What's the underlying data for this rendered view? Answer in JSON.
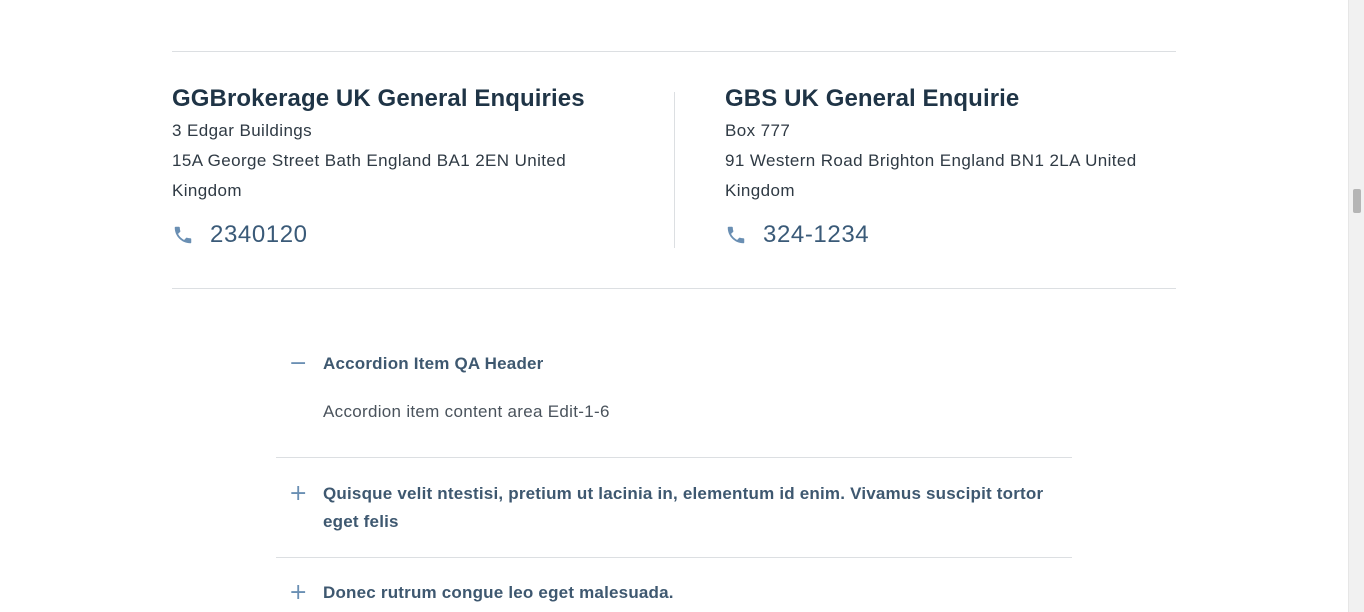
{
  "contacts": [
    {
      "title": "GGBrokerage UK General Enquiries",
      "address_line_1": "3 Edgar Buildings",
      "address_line_2": "15A George Street Bath England BA1 2EN United",
      "address_line_3": "Kingdom",
      "phone": "2340120",
      "phone_icon": "phone-icon"
    },
    {
      "title": "GBS UK General Enquirie",
      "address_line_1": "Box 777",
      "address_line_2": "91 Western Road Brighton England BN1 2LA United",
      "address_line_3": "Kingdom",
      "phone": "324-1234",
      "phone_icon": "phone-icon"
    }
  ],
  "accordion": {
    "items": [
      {
        "toggle": "−",
        "state": "expanded",
        "title": "Accordion Item QA Header",
        "content": "Accordion item content area Edit-1-6"
      },
      {
        "toggle": "+",
        "state": "collapsed",
        "title": "Quisque velit ntestisi, pretium ut lacinia in, elementum id enim. Vivamus suscipit tortor eget felis"
      },
      {
        "toggle": "+",
        "state": "collapsed",
        "title": "Donec rutrum congue leo eget malesuada."
      }
    ]
  },
  "colors": {
    "accent": "#6a8fb3",
    "title": "#1f3446",
    "phone": "#3a5a78",
    "divider": "#dcdfe2"
  }
}
